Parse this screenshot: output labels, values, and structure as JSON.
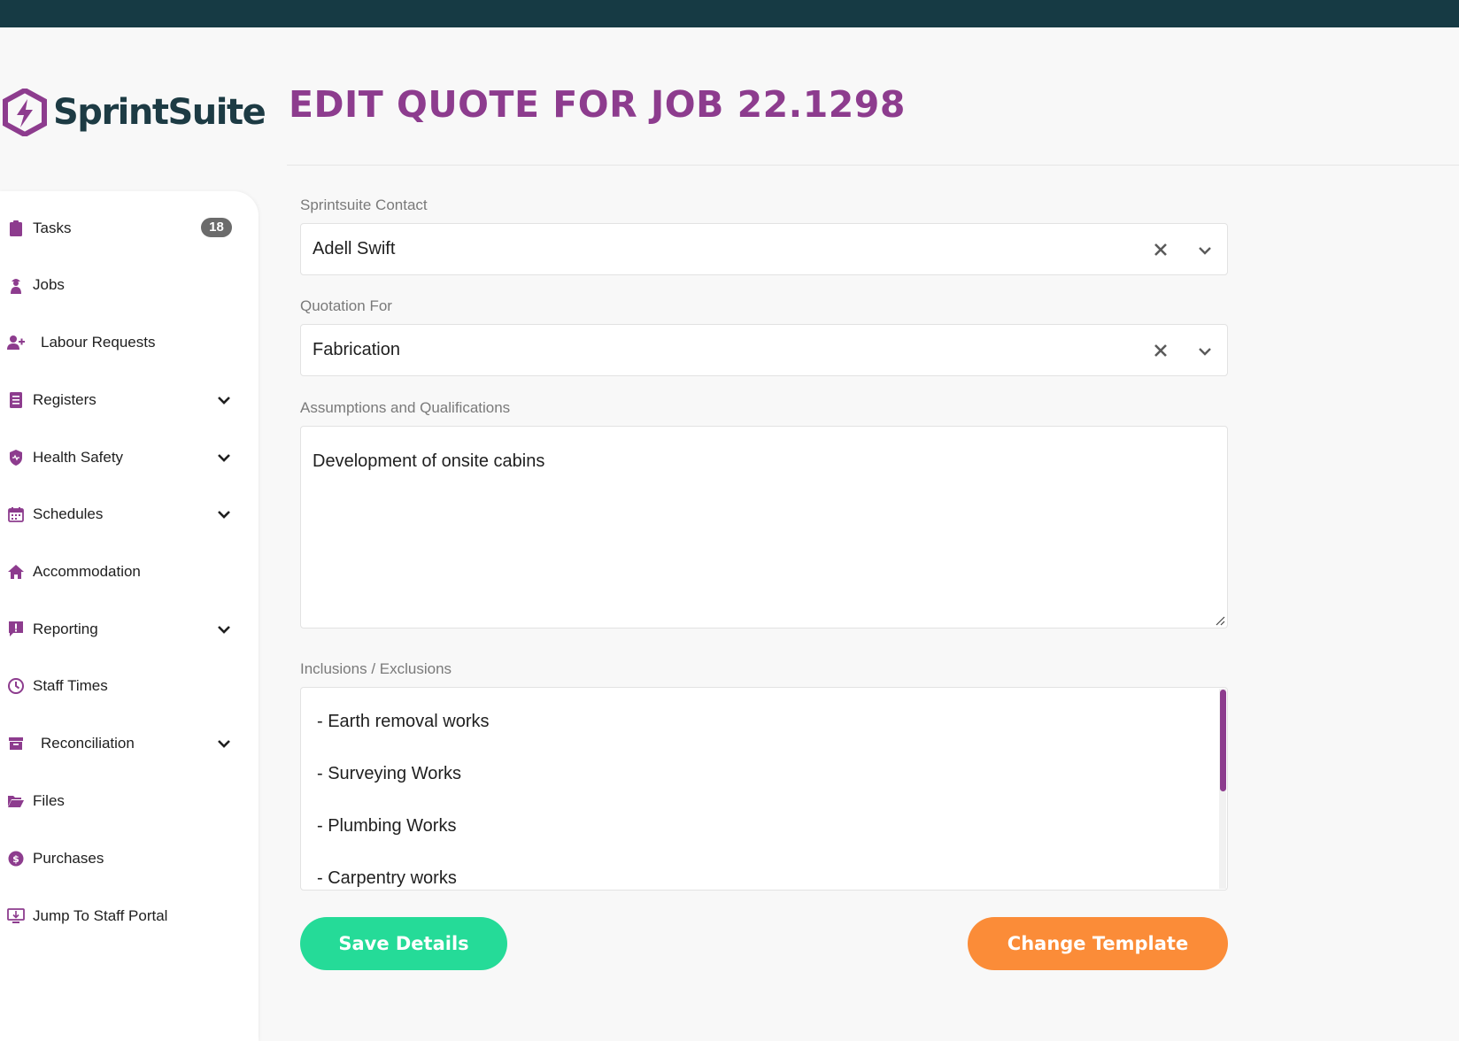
{
  "app": {
    "logo_text": "SprintSuite",
    "page_title": "EDIT QUOTE FOR JOB 22.1298"
  },
  "colors": {
    "topbar": "#163a44",
    "accent": "#8d3c8e",
    "save_button": "#25db98",
    "template_button": "#fb8c38"
  },
  "sidebar": {
    "items": [
      {
        "label": "Tasks",
        "icon": "clipboard-icon",
        "badge": "18"
      },
      {
        "label": "Jobs",
        "icon": "worker-icon"
      },
      {
        "label": "Labour Requests",
        "icon": "user-plus-icon"
      },
      {
        "label": "Registers",
        "icon": "list-icon",
        "expandable": true
      },
      {
        "label": "Health Safety",
        "icon": "shield-icon",
        "expandable": true
      },
      {
        "label": "Schedules",
        "icon": "calendar-icon",
        "expandable": true
      },
      {
        "label": "Accommodation",
        "icon": "home-icon"
      },
      {
        "label": "Reporting",
        "icon": "alert-message-icon",
        "expandable": true
      },
      {
        "label": "Staff Times",
        "icon": "clock-icon"
      },
      {
        "label": "Reconciliation",
        "icon": "archive-icon",
        "expandable": true
      },
      {
        "label": "Files",
        "icon": "folder-open-icon"
      },
      {
        "label": "Purchases",
        "icon": "dollar-circle-icon"
      },
      {
        "label": "Jump To Staff Portal",
        "icon": "monitor-download-icon"
      }
    ]
  },
  "form": {
    "contact": {
      "label": "Sprintsuite Contact",
      "value": "Adell Swift"
    },
    "quotation_for": {
      "label": "Quotation For",
      "value": "Fabrication"
    },
    "assumptions": {
      "label": "Assumptions and Qualifications",
      "value": "Development of onsite cabins"
    },
    "inclusions": {
      "label": "Inclusions / Exclusions",
      "lines": [
        "- Earth removal works",
        "- Surveying Works",
        "- Plumbing Works",
        "- Carpentry works"
      ]
    }
  },
  "buttons": {
    "save": "Save Details",
    "change_template": "Change Template"
  }
}
